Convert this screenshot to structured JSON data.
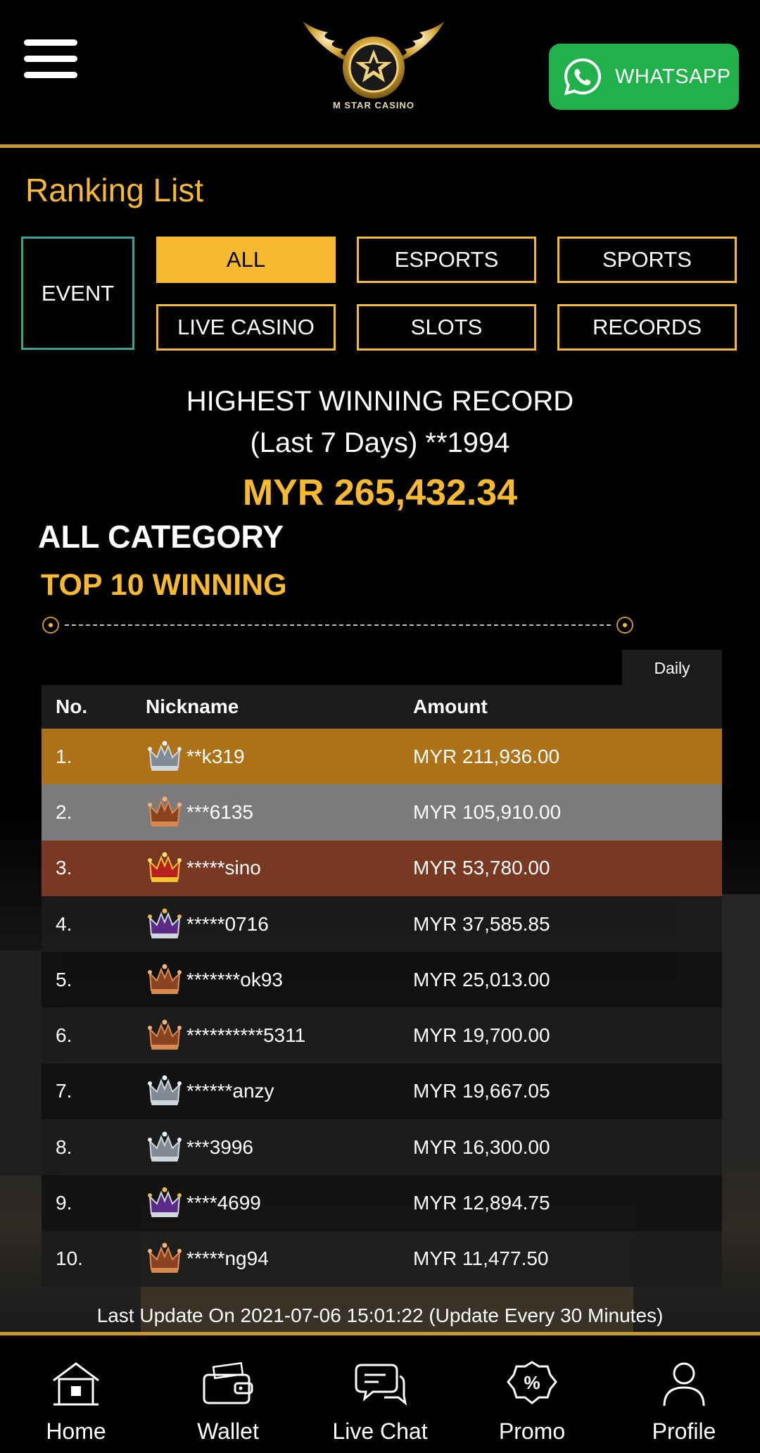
{
  "header": {
    "logo_text": "M STAR CASINO",
    "whatsapp_label": "WHATSAPP"
  },
  "ranking": {
    "title": "Ranking List",
    "event_label": "EVENT",
    "tabs": [
      {
        "label": "ALL",
        "active": true
      },
      {
        "label": "ESPORTS",
        "active": false
      },
      {
        "label": "SPORTS",
        "active": false
      },
      {
        "label": "LIVE CASINO",
        "active": false
      },
      {
        "label": "SLOTS",
        "active": false
      },
      {
        "label": "RECORDS",
        "active": false
      }
    ]
  },
  "highest": {
    "line1": "HIGHEST WINNING RECORD",
    "line2": "(Last 7 Days) **1994",
    "amount": "MYR 265,432.34"
  },
  "category": {
    "title": "ALL CATEGORY",
    "subtitle": "TOP 10 WINNING"
  },
  "table": {
    "period_tab": "Daily",
    "headers": {
      "no": "No.",
      "nickname": "Nickname",
      "amount": "Amount"
    },
    "rows": [
      {
        "no": "1.",
        "nickname": "**k319",
        "amount": "MYR 211,936.00",
        "crown": "silver-crown-icon",
        "highlight": "#ad7118"
      },
      {
        "no": "2.",
        "nickname": "***6135",
        "amount": "MYR 105,910.00",
        "crown": "bronze-crown-icon",
        "highlight": "#7b7b7b"
      },
      {
        "no": "3.",
        "nickname": "*****sino",
        "amount": "MYR 53,780.00",
        "crown": "gold-crown-icon",
        "highlight": "#783822"
      },
      {
        "no": "4.",
        "nickname": "*****0716",
        "amount": "MYR 37,585.85",
        "crown": "purple-crown-icon",
        "highlight": ""
      },
      {
        "no": "5.",
        "nickname": "*******ok93",
        "amount": "MYR 25,013.00",
        "crown": "bronze-crown-icon",
        "highlight": ""
      },
      {
        "no": "6.",
        "nickname": "**********5311",
        "amount": "MYR 19,700.00",
        "crown": "bronze-crown-icon",
        "highlight": ""
      },
      {
        "no": "7.",
        "nickname": "******anzy",
        "amount": "MYR 19,667.05",
        "crown": "silver-crown-icon",
        "highlight": ""
      },
      {
        "no": "8.",
        "nickname": "***3996",
        "amount": "MYR 16,300.00",
        "crown": "silver-crown-icon",
        "highlight": ""
      },
      {
        "no": "9.",
        "nickname": "****4699",
        "amount": "MYR 12,894.75",
        "crown": "purple-crown-icon",
        "highlight": ""
      },
      {
        "no": "10.",
        "nickname": "*****ng94",
        "amount": "MYR 11,477.50",
        "crown": "bronze-crown-icon",
        "highlight": ""
      }
    ],
    "last_update": "Last Update On 2021-07-06 15:01:22 (Update Every 30 Minutes)"
  },
  "bottom_nav": [
    {
      "label": "Home",
      "icon": "home-icon"
    },
    {
      "label": "Wallet",
      "icon": "wallet-icon"
    },
    {
      "label": "Live Chat",
      "icon": "chat-icon"
    },
    {
      "label": "Promo",
      "icon": "promo-icon"
    },
    {
      "label": "Profile",
      "icon": "profile-icon"
    }
  ],
  "colors": {
    "accent": "#f6b92f",
    "border_gold": "#c9982a",
    "whatsapp": "#21b14b",
    "event_border": "#3aa494"
  }
}
